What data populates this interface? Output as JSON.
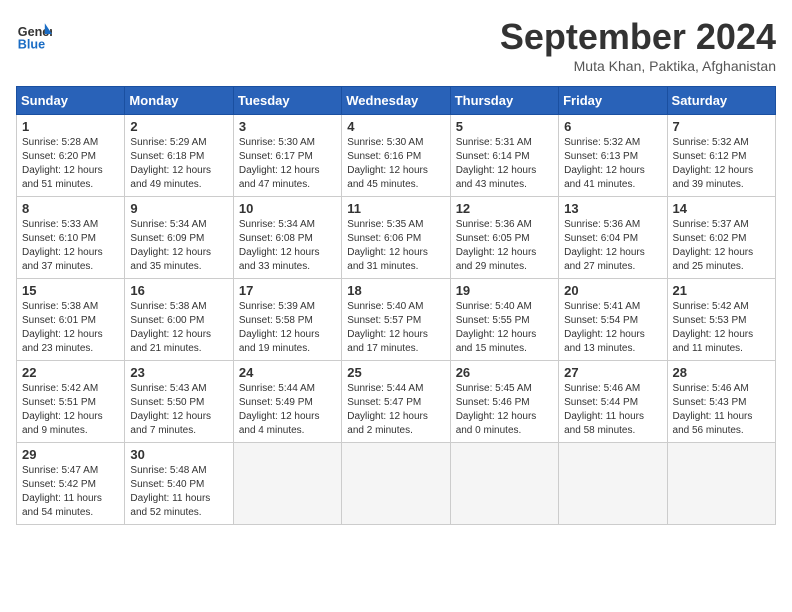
{
  "header": {
    "logo_line1": "General",
    "logo_line2": "Blue",
    "month": "September 2024",
    "location": "Muta Khan, Paktika, Afghanistan"
  },
  "weekdays": [
    "Sunday",
    "Monday",
    "Tuesday",
    "Wednesday",
    "Thursday",
    "Friday",
    "Saturday"
  ],
  "weeks": [
    [
      {
        "day": 1,
        "sunrise": "5:28 AM",
        "sunset": "6:20 PM",
        "daylight": "12 hours and 51 minutes."
      },
      {
        "day": 2,
        "sunrise": "5:29 AM",
        "sunset": "6:18 PM",
        "daylight": "12 hours and 49 minutes."
      },
      {
        "day": 3,
        "sunrise": "5:30 AM",
        "sunset": "6:17 PM",
        "daylight": "12 hours and 47 minutes."
      },
      {
        "day": 4,
        "sunrise": "5:30 AM",
        "sunset": "6:16 PM",
        "daylight": "12 hours and 45 minutes."
      },
      {
        "day": 5,
        "sunrise": "5:31 AM",
        "sunset": "6:14 PM",
        "daylight": "12 hours and 43 minutes."
      },
      {
        "day": 6,
        "sunrise": "5:32 AM",
        "sunset": "6:13 PM",
        "daylight": "12 hours and 41 minutes."
      },
      {
        "day": 7,
        "sunrise": "5:32 AM",
        "sunset": "6:12 PM",
        "daylight": "12 hours and 39 minutes."
      }
    ],
    [
      {
        "day": 8,
        "sunrise": "5:33 AM",
        "sunset": "6:10 PM",
        "daylight": "12 hours and 37 minutes."
      },
      {
        "day": 9,
        "sunrise": "5:34 AM",
        "sunset": "6:09 PM",
        "daylight": "12 hours and 35 minutes."
      },
      {
        "day": 10,
        "sunrise": "5:34 AM",
        "sunset": "6:08 PM",
        "daylight": "12 hours and 33 minutes."
      },
      {
        "day": 11,
        "sunrise": "5:35 AM",
        "sunset": "6:06 PM",
        "daylight": "12 hours and 31 minutes."
      },
      {
        "day": 12,
        "sunrise": "5:36 AM",
        "sunset": "6:05 PM",
        "daylight": "12 hours and 29 minutes."
      },
      {
        "day": 13,
        "sunrise": "5:36 AM",
        "sunset": "6:04 PM",
        "daylight": "12 hours and 27 minutes."
      },
      {
        "day": 14,
        "sunrise": "5:37 AM",
        "sunset": "6:02 PM",
        "daylight": "12 hours and 25 minutes."
      }
    ],
    [
      {
        "day": 15,
        "sunrise": "5:38 AM",
        "sunset": "6:01 PM",
        "daylight": "12 hours and 23 minutes."
      },
      {
        "day": 16,
        "sunrise": "5:38 AM",
        "sunset": "6:00 PM",
        "daylight": "12 hours and 21 minutes."
      },
      {
        "day": 17,
        "sunrise": "5:39 AM",
        "sunset": "5:58 PM",
        "daylight": "12 hours and 19 minutes."
      },
      {
        "day": 18,
        "sunrise": "5:40 AM",
        "sunset": "5:57 PM",
        "daylight": "12 hours and 17 minutes."
      },
      {
        "day": 19,
        "sunrise": "5:40 AM",
        "sunset": "5:55 PM",
        "daylight": "12 hours and 15 minutes."
      },
      {
        "day": 20,
        "sunrise": "5:41 AM",
        "sunset": "5:54 PM",
        "daylight": "12 hours and 13 minutes."
      },
      {
        "day": 21,
        "sunrise": "5:42 AM",
        "sunset": "5:53 PM",
        "daylight": "12 hours and 11 minutes."
      }
    ],
    [
      {
        "day": 22,
        "sunrise": "5:42 AM",
        "sunset": "5:51 PM",
        "daylight": "12 hours and 9 minutes."
      },
      {
        "day": 23,
        "sunrise": "5:43 AM",
        "sunset": "5:50 PM",
        "daylight": "12 hours and 7 minutes."
      },
      {
        "day": 24,
        "sunrise": "5:44 AM",
        "sunset": "5:49 PM",
        "daylight": "12 hours and 4 minutes."
      },
      {
        "day": 25,
        "sunrise": "5:44 AM",
        "sunset": "5:47 PM",
        "daylight": "12 hours and 2 minutes."
      },
      {
        "day": 26,
        "sunrise": "5:45 AM",
        "sunset": "5:46 PM",
        "daylight": "12 hours and 0 minutes."
      },
      {
        "day": 27,
        "sunrise": "5:46 AM",
        "sunset": "5:44 PM",
        "daylight": "11 hours and 58 minutes."
      },
      {
        "day": 28,
        "sunrise": "5:46 AM",
        "sunset": "5:43 PM",
        "daylight": "11 hours and 56 minutes."
      }
    ],
    [
      {
        "day": 29,
        "sunrise": "5:47 AM",
        "sunset": "5:42 PM",
        "daylight": "11 hours and 54 minutes."
      },
      {
        "day": 30,
        "sunrise": "5:48 AM",
        "sunset": "5:40 PM",
        "daylight": "11 hours and 52 minutes."
      },
      null,
      null,
      null,
      null,
      null
    ]
  ]
}
